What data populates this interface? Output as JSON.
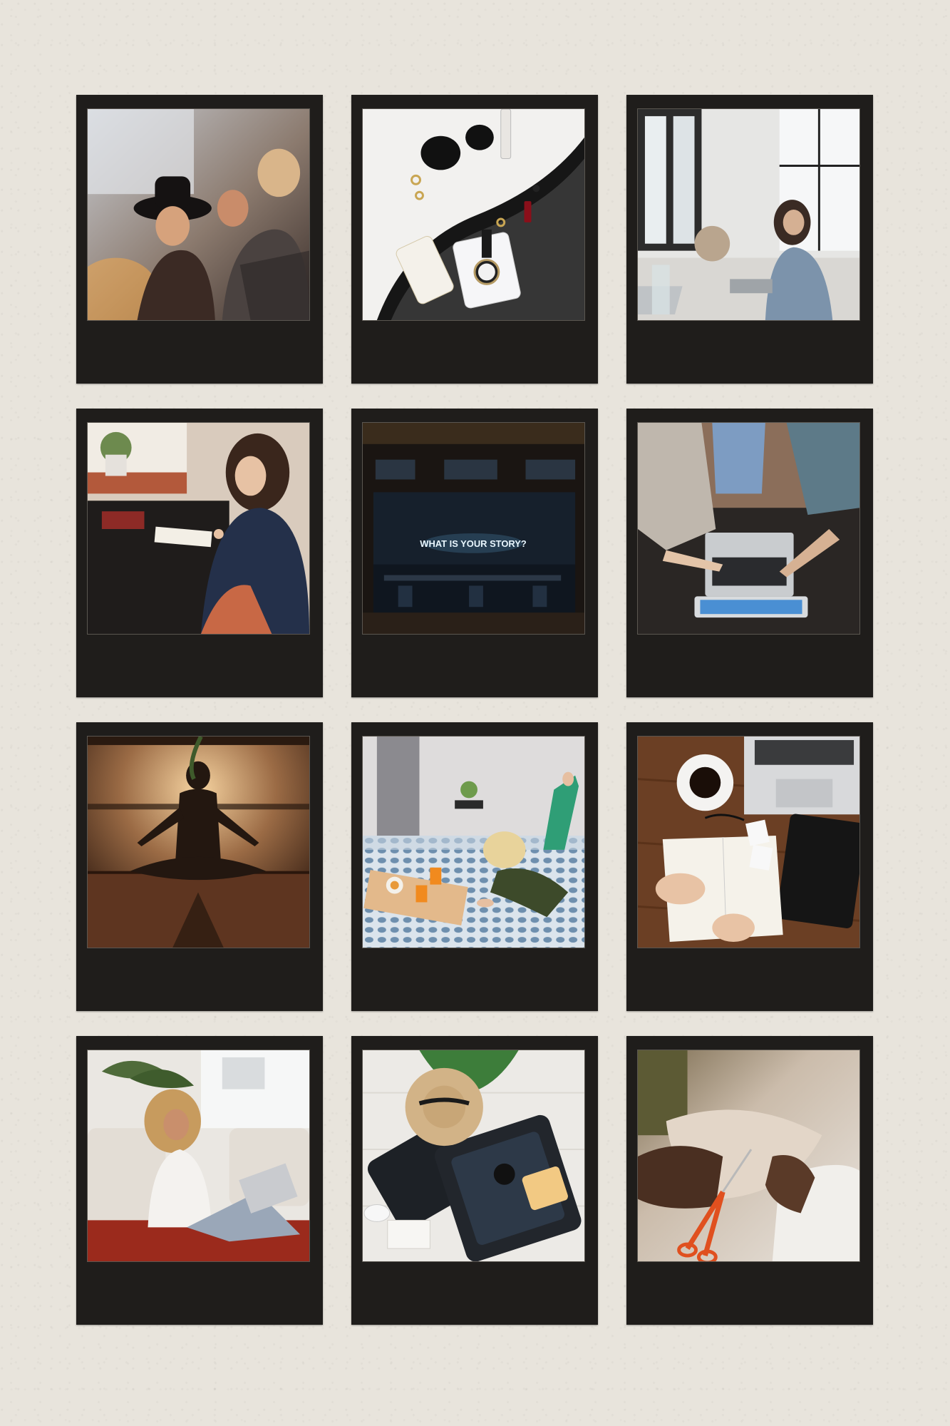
{
  "photos": [
    {
      "subject": "friends-laughing"
    },
    {
      "subject": "flatlay-accessories"
    },
    {
      "subject": "woman-cafe-window"
    },
    {
      "subject": "woman-writing-desk"
    },
    {
      "subject": "neon-sign-window",
      "sign_text": "WHAT IS YOUR STORY?"
    },
    {
      "subject": "group-laptop-overhead"
    },
    {
      "subject": "yoga-meditation"
    },
    {
      "subject": "breakfast-in-bed"
    },
    {
      "subject": "journal-coffee-laptop"
    },
    {
      "subject": "woman-laptop-floor"
    },
    {
      "subject": "open-suitcase-hat"
    },
    {
      "subject": "hands-scissors-fabric"
    }
  ],
  "colors": {
    "background": "#e8e4dc",
    "frame": "#1f1d1b"
  }
}
